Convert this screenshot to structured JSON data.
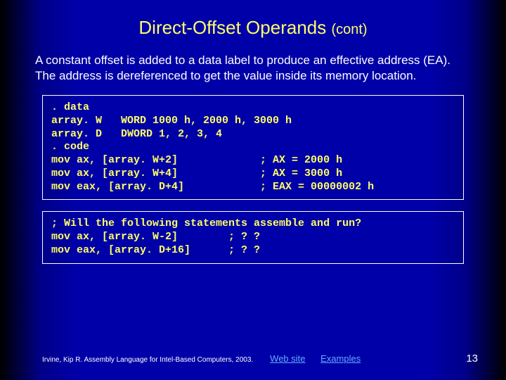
{
  "title": {
    "main": "Direct-Offset Operands",
    "sub": "(cont)"
  },
  "body_text": "A constant offset is added to a data label to produce an effective address (EA). The address is dereferenced to get the value inside its memory location.",
  "code1": ". data\narray. W   WORD 1000 h, 2000 h, 3000 h\narray. D   DWORD 1, 2, 3, 4\n. code\nmov ax, [array. W+2]             ; AX = 2000 h\nmov ax, [array. W+4]             ; AX = 3000 h\nmov eax, [array. D+4]            ; EAX = 00000002 h",
  "code2": "; Will the following statements assemble and run?\nmov ax, [array. W-2]        ; ? ?\nmov eax, [array. D+16]      ; ? ?",
  "footer": {
    "citation": "Irvine, Kip R. Assembly Language for Intel-Based Computers, 2003.",
    "link1": "Web site",
    "link2": "Examples",
    "page": "13"
  }
}
